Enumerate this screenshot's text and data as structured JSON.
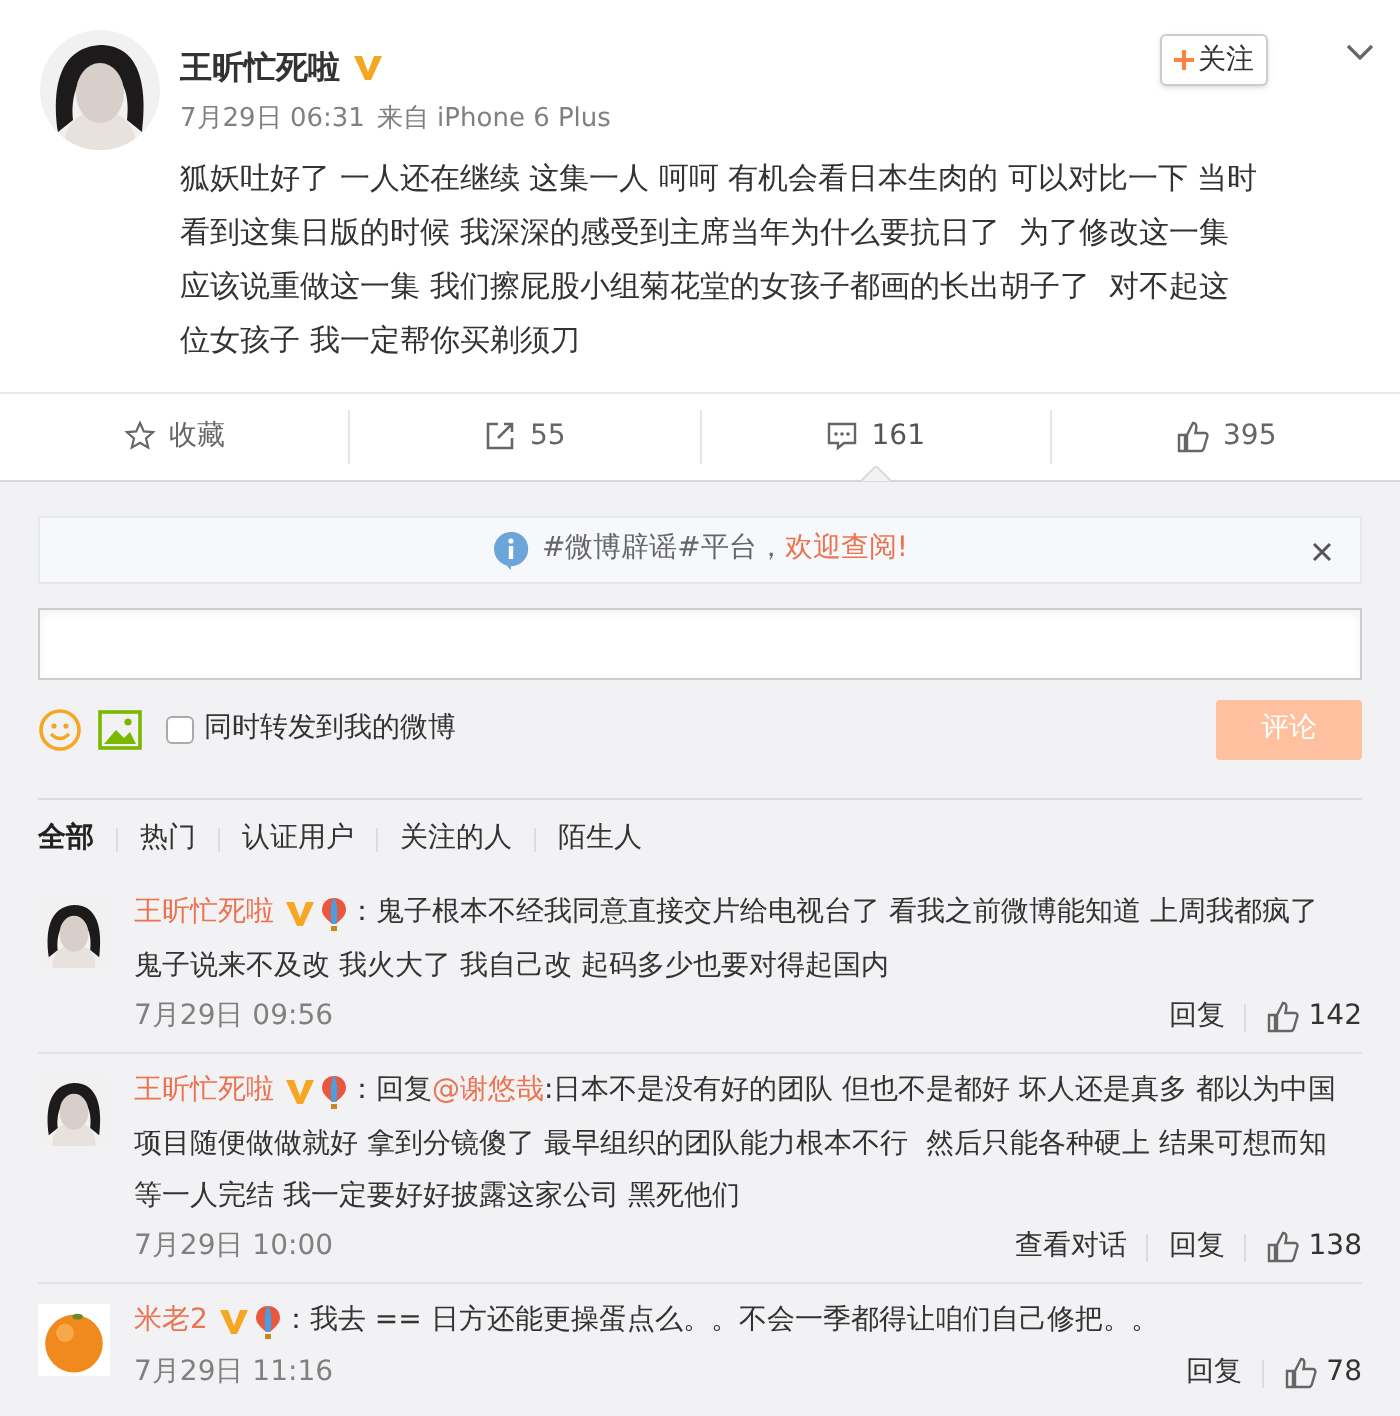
{
  "post": {
    "author": "王昕忙死啦",
    "verified": true,
    "time": "7月29日 06:31",
    "source": "来自 iPhone 6 Plus",
    "follow_label": "关注",
    "text_lines": [
      "狐妖吐好了 一人还在继续 这集一人 呵呵 有机会看日本生肉的 可以对比一下 当时",
      "看到这集日版的时候 我深深的感受到主席当年为什么要抗日了  为了修改这一集",
      "应该说重做这一集 我们擦屁股小组菊花堂的女孩子都画的长出胡子了  对不起这",
      "位女孩子 我一定帮你买剃须刀"
    ],
    "actions": [
      {
        "kind": "favorite",
        "label": "收藏",
        "selected": false
      },
      {
        "kind": "repost",
        "label": "55",
        "selected": false
      },
      {
        "kind": "comment",
        "label": "161",
        "selected": true
      },
      {
        "kind": "like",
        "label": "395",
        "selected": false
      }
    ]
  },
  "notice": {
    "text": "#微博辟谣#平台，",
    "link": "欢迎查阅!"
  },
  "composer": {
    "repost_label": "同时转发到我的微博",
    "repost_checked": false,
    "submit_label": "评论",
    "submit_disabled": true
  },
  "filters": [
    {
      "label": "全部",
      "selected": true
    },
    {
      "label": "热门",
      "selected": false
    },
    {
      "label": "认证用户",
      "selected": false
    },
    {
      "label": "关注的人",
      "selected": false
    },
    {
      "label": "陌生人",
      "selected": false
    }
  ],
  "comments": [
    {
      "kind": "person",
      "name": "王昕忙死啦",
      "separator": "：",
      "text_lines": [
        "鬼子根本不经我同意直接交片给电视台了 看我之前微博能知道 上周我都疯了",
        "鬼子说来不及改 我火大了 我自己改 起码多少也要对得起国内"
      ],
      "time": "7月29日 09:56",
      "reply_label": "回复",
      "likes": "142"
    },
    {
      "kind": "person",
      "name": "王昕忙死啦",
      "separator": "：",
      "reply_prefix": "回复",
      "mention": "@谢悠哉",
      "text_lines": [
        ":日本不是没有好的团队 但也不是都好 坏人还是真多 都以为中国",
        "项目随便做做就好 拿到分镜傻了 最早组织的团队能力根本不行  然后只能各种硬上 结果可想而知",
        "等一人完结 我一定要好好披露这家公司 黑死他们"
      ],
      "time": "7月29日 10:00",
      "conversation_label": "查看对话",
      "reply_label": "回复",
      "likes": "138"
    },
    {
      "kind": "picture",
      "name": "米老2",
      "separator": "：",
      "text_lines": [
        "我去 == 日方还能更操蛋点么。。不会一季都得让咱们自己修把。。"
      ],
      "time": "7月29日 11:16",
      "reply_label": "回复",
      "likes": "78"
    }
  ]
}
